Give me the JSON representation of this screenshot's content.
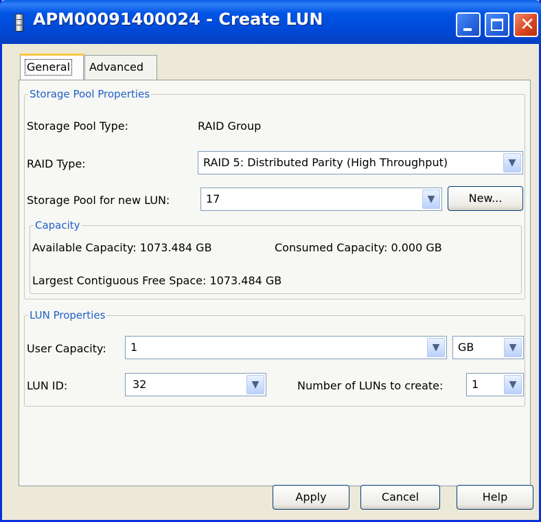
{
  "window": {
    "title": "APM00091400024 - Create LUN"
  },
  "tabs": [
    {
      "label": "General",
      "selected": true
    },
    {
      "label": "Advanced",
      "selected": false
    }
  ],
  "storage_pool_properties": {
    "legend": "Storage Pool Properties",
    "pool_type_label": "Storage Pool Type:",
    "pool_type_value": "RAID Group",
    "raid_type_label": "RAID Type:",
    "raid_type_value": "RAID 5: Distributed Parity (High Throughput)",
    "pool_for_lun_label": "Storage Pool for new LUN:",
    "pool_for_lun_value": "17",
    "new_button": "New..."
  },
  "capacity": {
    "legend": "Capacity",
    "available": "Available Capacity: 1073.484 GB",
    "consumed": "Consumed Capacity: 0.000 GB",
    "largest_free": "Largest Contiguous Free Space: 1073.484 GB"
  },
  "lun_properties": {
    "legend": "LUN Properties",
    "user_capacity_label": "User Capacity:",
    "user_capacity_value": "1",
    "unit_value": "GB",
    "lun_id_label": "LUN ID:",
    "lun_id_value": "32",
    "num_luns_label": "Number of LUNs to create:",
    "num_luns_value": "1"
  },
  "buttons": {
    "apply": "Apply",
    "cancel": "Cancel",
    "help": "Help"
  },
  "colors": {
    "titlebar": "#0055e5",
    "legend_text": "#1f5fc7",
    "dialog_bg": "#ece9d8"
  }
}
